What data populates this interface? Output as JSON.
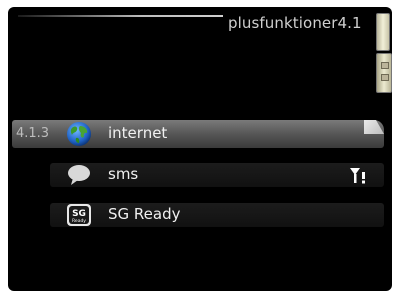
{
  "header": {
    "title": "plusfunktioner4.1"
  },
  "menu": {
    "items": [
      {
        "num": "4.1.3",
        "label": "internet",
        "icon": "globe-icon",
        "selected": true
      },
      {
        "num": "",
        "label": "sms",
        "icon": "speech-bubble-icon",
        "status_icon": "antenna-warning-icon"
      },
      {
        "num": "",
        "label": "SG Ready",
        "icon": "sg-ready-icon",
        "icon_text": "SG",
        "icon_subtext": "Ready"
      }
    ]
  },
  "colors": {
    "screen_bg": "#000000",
    "selected_row": "#5a5a5a",
    "text": "#f0f0f0",
    "title_text": "#cfcfcf"
  }
}
